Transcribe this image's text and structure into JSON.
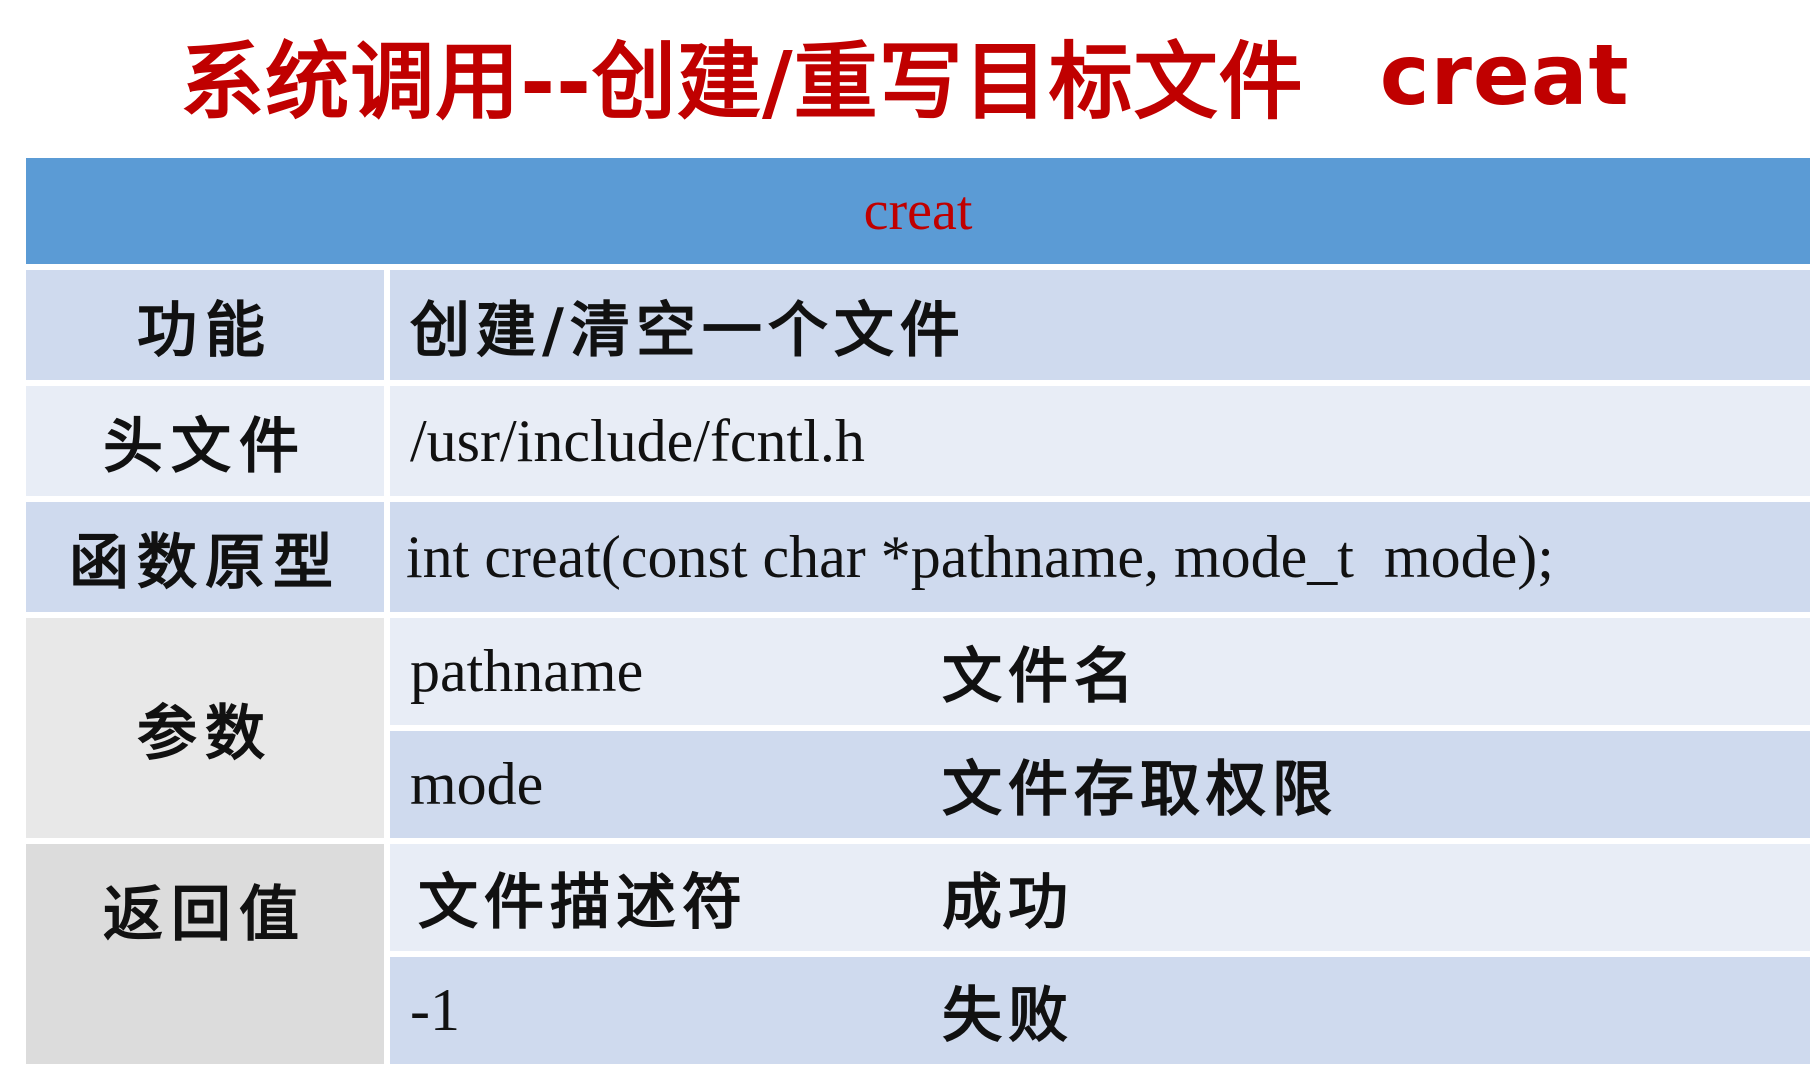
{
  "title": {
    "main": "系统调用--创建/重写目标文件",
    "func": "creat"
  },
  "table": {
    "header": "creat",
    "rows": [
      {
        "label": "功能",
        "value": "创建/清空一个文件"
      },
      {
        "label": "头文件",
        "value": "/usr/include/fcntl.h"
      },
      {
        "label": "函数原型",
        "value": "int creat(const char *pathname, mode_t  mode);"
      }
    ],
    "params": {
      "label": "参数",
      "items": [
        {
          "name": "pathname",
          "desc": "文件名"
        },
        {
          "name": "mode",
          "desc": "文件存取权限"
        }
      ]
    },
    "returns": {
      "label": "返回值",
      "items": [
        {
          "value": "文件描述符",
          "meaning": "成功"
        },
        {
          "value": "-1",
          "meaning": "失败"
        }
      ]
    }
  },
  "colors": {
    "title": "#c00000",
    "header_bg": "#5b9bd5",
    "row_dark": "#cfdaee",
    "row_light": "#e8edf6"
  }
}
